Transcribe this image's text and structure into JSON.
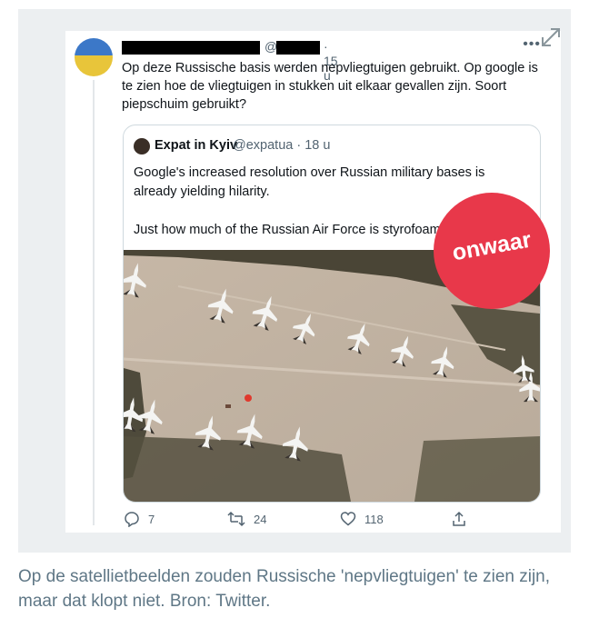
{
  "tweet": {
    "at_sign": "@",
    "time": "· 15 u",
    "text": "Op deze Russische basis werden nepvliegtuigen gebruikt. Op google is te zien hoe de vliegtuigen in stukken uit elkaar gevallen zijn. Soort piepschuim gebruikt?",
    "more_icon": "more-icon",
    "expand_icon": "expand-icon"
  },
  "quote": {
    "name": "Expat in Kyiv",
    "handle": "@expatua · 18 u",
    "text_1": "Google's increased resolution over Russian military bases is already yielding hilarity.",
    "text_2": "Just how much of the Russian Air Force is styrofoam?"
  },
  "actions": {
    "replies": "7",
    "retweets": "24",
    "likes": "118"
  },
  "badge": {
    "label": "onwaar",
    "color": "#e8384a"
  },
  "caption": "Op de satellietbeelden zouden Russische 'nepvliegtuigen' te zien zijn, maar dat klopt niet. Bron: Twitter."
}
